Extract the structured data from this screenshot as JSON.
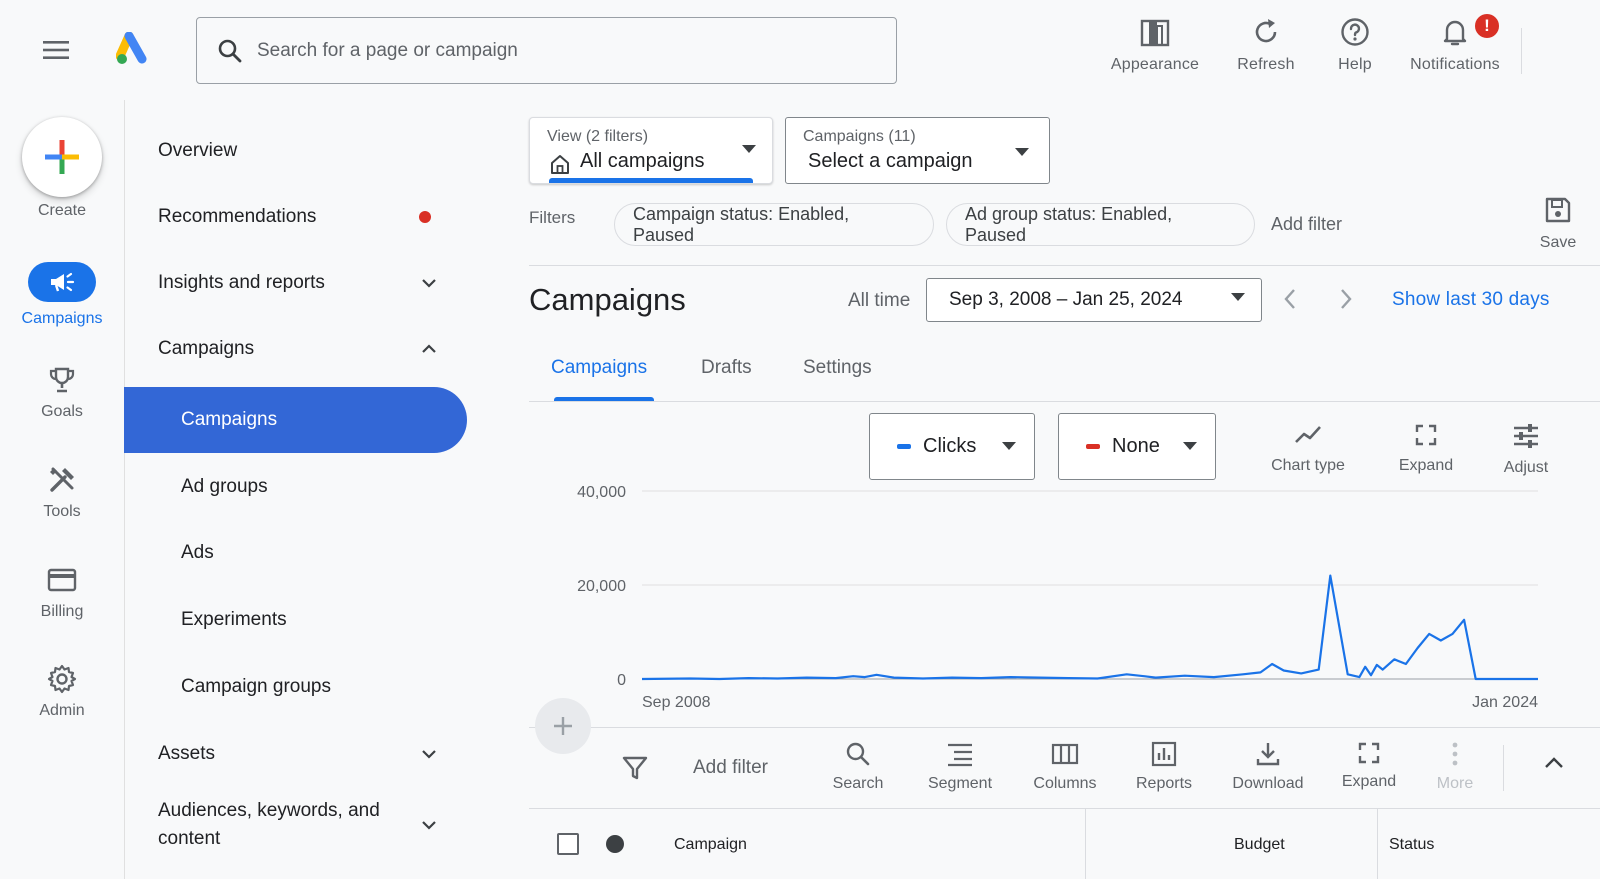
{
  "header": {
    "search_placeholder": "Search for a page or campaign",
    "buttons": {
      "appearance": "Appearance",
      "refresh": "Refresh",
      "help": "Help",
      "notifications": "Notifications"
    },
    "notification_badge": "!"
  },
  "rail": {
    "create": "Create",
    "items": {
      "campaigns": "Campaigns",
      "goals": "Goals",
      "tools": "Tools",
      "billing": "Billing",
      "admin": "Admin"
    }
  },
  "nav": {
    "overview": "Overview",
    "recommendations": "Recommendations",
    "insights": "Insights and reports",
    "campaigns_group": "Campaigns",
    "campaigns": "Campaigns",
    "ad_groups": "Ad groups",
    "ads": "Ads",
    "experiments": "Experiments",
    "campaign_groups": "Campaign groups",
    "assets": "Assets",
    "audiences": "Audiences, keywords, and content"
  },
  "view_card": {
    "label": "View (2 filters)",
    "value": "All campaigns"
  },
  "campaign_card": {
    "label": "Campaigns (11)",
    "value": "Select a campaign"
  },
  "filters": {
    "label": "Filters",
    "chips": [
      "Campaign status: Enabled, Paused",
      "Ad group status: Enabled, Paused"
    ],
    "add": "Add filter",
    "save": "Save"
  },
  "page": {
    "title": "Campaigns",
    "all_time": "All time",
    "date_range": "Sep 3, 2008 – Jan 25, 2024",
    "show_last": "Show last 30 days"
  },
  "tabs": [
    "Campaigns",
    "Drafts",
    "Settings"
  ],
  "chart_controls": {
    "metric1": "Clicks",
    "metric1_color": "#1a73e8",
    "metric2": "None",
    "metric2_color": "#d93025",
    "chart_type": "Chart type",
    "expand": "Expand",
    "adjust": "Adjust"
  },
  "chart_data": {
    "type": "line",
    "title": "",
    "xlabel": "",
    "ylabel": "",
    "y_ticks": [
      "40,000",
      "20,000",
      "0"
    ],
    "x_tick_labels": [
      "Sep 2008",
      "Jan 2024"
    ],
    "ylim": [
      0,
      40000
    ],
    "grid": true,
    "series": [
      {
        "name": "Clicks",
        "color": "#1a73e8",
        "x_year": [
          2008.67,
          2009.5,
          2010,
          2010.5,
          2011,
          2011.5,
          2012,
          2012.3,
          2012.5,
          2012.7,
          2013,
          2013.5,
          2014,
          2014.5,
          2015,
          2015.5,
          2016,
          2016.5,
          2017,
          2017.3,
          2017.5,
          2018,
          2018.5,
          2019,
          2019.3,
          2019.5,
          2019.7,
          2020,
          2020.3,
          2020.5,
          2020.8,
          2021.0,
          2021.1,
          2021.2,
          2021.3,
          2021.4,
          2021.6,
          2021.8,
          2022.0,
          2022.2,
          2022.4,
          2022.6,
          2022.8,
          2023.0,
          2023.2,
          2023.4,
          2023.5,
          2023.6,
          2023.8,
          2024.07
        ],
        "values": [
          0,
          100,
          0,
          200,
          100,
          300,
          200,
          600,
          400,
          900,
          300,
          100,
          300,
          200,
          400,
          300,
          200,
          100,
          1000,
          600,
          300,
          700,
          400,
          1000,
          1400,
          3200,
          1800,
          1200,
          2000,
          22000,
          1000,
          400,
          2600,
          800,
          3000,
          2000,
          4200,
          3200,
          6600,
          9600,
          8200,
          9600,
          12600,
          0,
          0,
          0,
          0,
          0,
          0,
          0
        ]
      }
    ]
  },
  "table_toolbar": {
    "add_filter": "Add filter",
    "search": "Search",
    "segment": "Segment",
    "columns": "Columns",
    "reports": "Reports",
    "download": "Download",
    "expand": "Expand",
    "more": "More"
  },
  "table": {
    "columns": [
      "Campaign",
      "Budget",
      "Status"
    ]
  }
}
